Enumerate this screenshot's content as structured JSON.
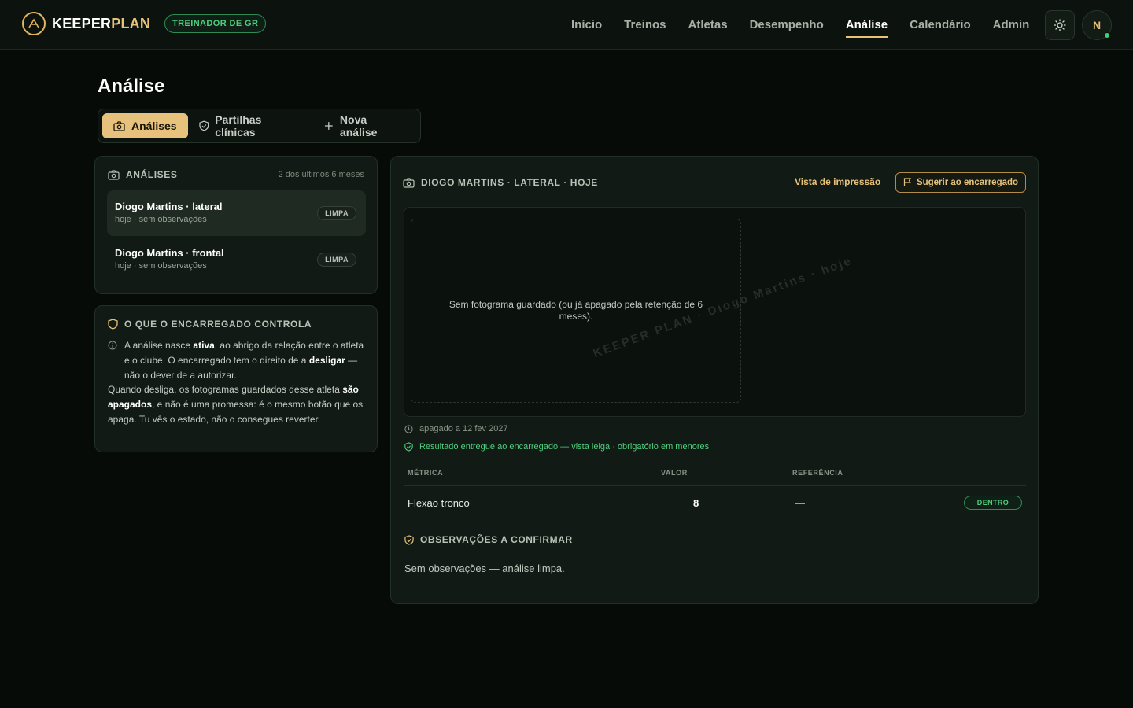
{
  "app": {
    "brand_part1": "KEEPER",
    "brand_part2": "PLAN",
    "role_badge": "TREINADOR DE GR",
    "avatar_initial": "N",
    "nav": [
      {
        "label": "Início"
      },
      {
        "label": "Treinos"
      },
      {
        "label": "Atletas"
      },
      {
        "label": "Desempenho"
      },
      {
        "label": "Análise",
        "active": true
      },
      {
        "label": "Calendário"
      },
      {
        "label": "Admin"
      }
    ]
  },
  "page": {
    "title": "Análise",
    "tabs": [
      {
        "label": "Análises",
        "icon": "camera-icon",
        "active": true
      },
      {
        "label": "Partilhas clínicas",
        "icon": "shield-check-icon"
      },
      {
        "label": "Nova análise",
        "icon": "plus-icon"
      }
    ]
  },
  "analyses_list": {
    "title": "ANÁLISES",
    "meta": "2 dos últimos 6 meses",
    "items": [
      {
        "title": "Diogo Martins · lateral",
        "subtitle": "hoje · sem observações",
        "badge": "LIMPA",
        "selected": true
      },
      {
        "title": "Diogo Martins · frontal",
        "subtitle": "hoje · sem observações",
        "badge": "LIMPA"
      }
    ]
  },
  "guardian_control": {
    "title": "O QUE O ENCARREGADO CONTROLA",
    "p1_a": "A análise nasce ",
    "p1_b": "ativa",
    "p1_c": ", ao abrigo da relação entre o atleta e o clube. O encarregado tem o direito de a ",
    "p1_d": "desligar",
    "p1_e": " — não o dever de a autorizar.",
    "p2_a": "Quando desliga, os fotogramas guardados desse atleta ",
    "p2_b": "são apagados",
    "p2_c": ", e não é uma promessa: é o mesmo botão que os apaga. Tu vês o estado, não o consegues reverter."
  },
  "detail": {
    "title": "DIOGO MARTINS · LATERAL · HOJE",
    "print_link": "Vista de impressão",
    "suggest_button": "Sugerir ao encarregado",
    "empty_frame": "Sem fotograma guardado (ou já apagado pela retenção de 6 meses).",
    "watermark": "KEEPER PLAN · Diogo Martins · hoje",
    "deleted": "apagado a 12 fev 2027",
    "delivered": "Resultado entregue ao encarregado — vista leiga · obrigatório em menores",
    "metrics_headers": {
      "metric": "MÉTRICA",
      "value": "VALOR",
      "reference": "REFERÊNCIA"
    },
    "metrics": [
      {
        "metric": "Flexao tronco",
        "value": "8",
        "reference": "—",
        "status": "DENTRO"
      }
    ],
    "observations_title": "OBSERVAÇÕES A CONFIRMAR",
    "observations_text": "Sem observações — análise limpa."
  },
  "colors": {
    "accent": "#e9c27a",
    "success": "#4fce7e",
    "background": "#070b08",
    "card": "#111a14"
  }
}
